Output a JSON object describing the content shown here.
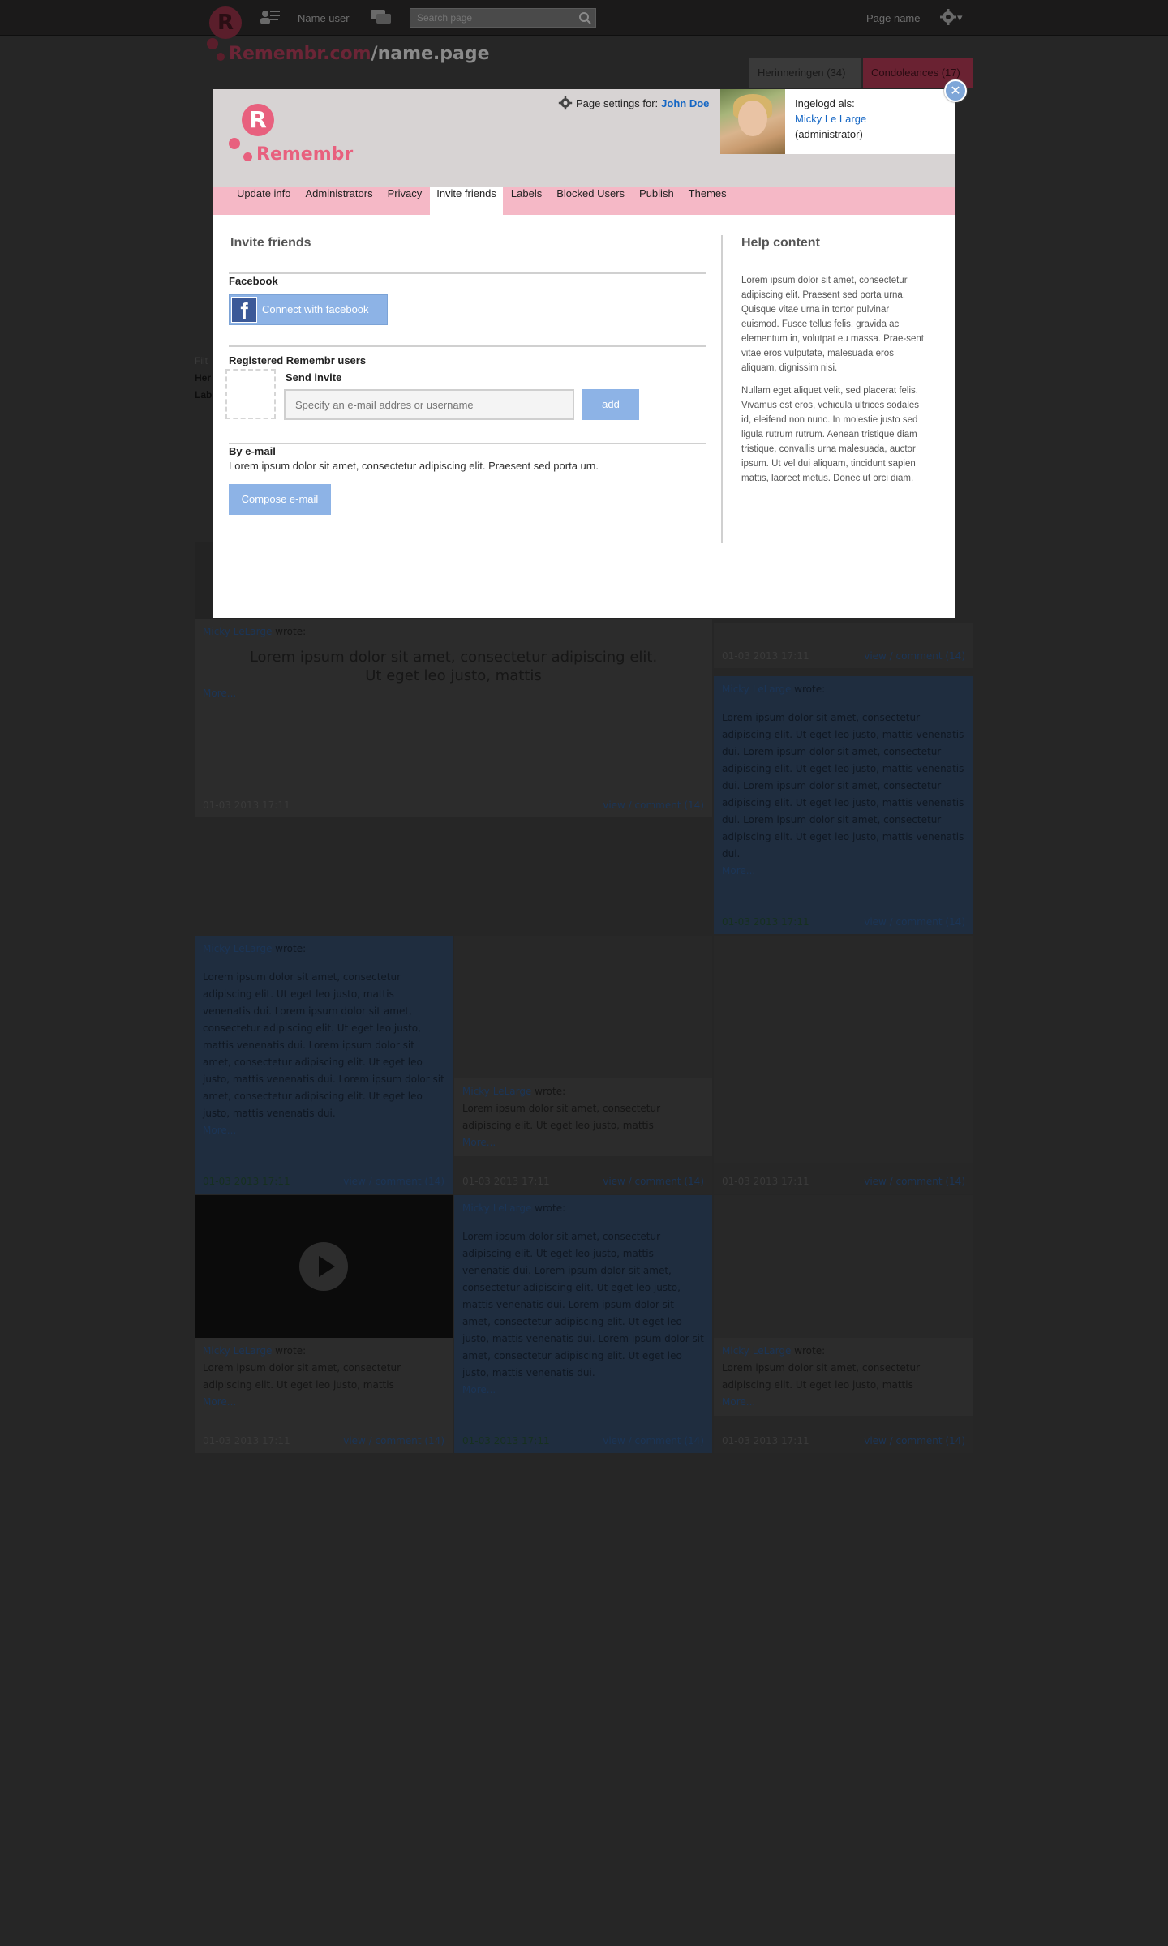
{
  "topbar": {
    "logo_letter": "R",
    "users_label": "Name user",
    "search_placeholder": "Search page",
    "page_name": "Page name",
    "settings_caret": "▾"
  },
  "header": {
    "site_brand": "Remembr.com",
    "separator": "/",
    "site_page": "name.page",
    "tab_memories": "Herinneringen (34)",
    "tab_condolences": "Condoleances (17)"
  },
  "feed": {
    "side_labels": [
      "Filt",
      "Her",
      "Lab"
    ],
    "author": "Micky LeLarge",
    "wrote": "wrote:",
    "quote_line1": "Lorem ipsum dolor sit amet, consectetur adipiscing elit.",
    "quote_line2": "Ut eget leo justo, mattis",
    "short_text": "Lorem ipsum dolor sit amet, consectetur adipiscing elit. Ut eget leo justo, mattis",
    "long_text": "Lorem ipsum dolor sit amet, consectetur adipiscing elit. Ut eget leo justo, mattis venenatis dui.  Lorem ipsum dolor sit amet, consectetur adipiscing elit. Ut eget leo justo, mattis venenatis dui. Lorem ipsum dolor sit amet, consectetur adipiscing elit. Ut eget leo justo, mattis venenatis dui. Lorem ipsum dolor sit amet, consectetur adipiscing elit. Ut eget leo justo, mattis venenatis dui.",
    "more": "More...",
    "date": "01-03 2013 17:11",
    "links": "view / comment (14)"
  },
  "modal": {
    "logo_letter": "R",
    "logo_word": "Remembr",
    "page_settings_label": "Page settings for:",
    "page_owner": "John Doe",
    "logged_in_label": "Ingelogd als:",
    "user_name": "Micky Le Large",
    "user_role": "(administrator)",
    "close_symbol": "✕",
    "tabs": [
      {
        "label": "Update info"
      },
      {
        "label": "Administrators"
      },
      {
        "label": "Privacy"
      },
      {
        "label": "Invite friends"
      },
      {
        "label": "Labels"
      },
      {
        "label": "Blocked Users"
      },
      {
        "label": "Publish"
      },
      {
        "label": "Themes"
      }
    ],
    "active_tab": "Invite friends",
    "invite": {
      "title": "Invite friends",
      "facebook_label": "Facebook",
      "facebook_button": "Connect with facebook",
      "facebook_glyph": "f",
      "registered_label": "Registered Remembr users",
      "send_invite_label": "Send invite",
      "invite_placeholder": "Specify an e-mail addres or username",
      "add_button": "add",
      "email_label": "By e-mail",
      "email_desc": "Lorem ipsum dolor sit amet, consectetur adipiscing elit. Praesent sed porta urn.",
      "compose_button": "Compose e-mail"
    },
    "help": {
      "title": "Help content",
      "paragraph1": "Lorem ipsum dolor sit amet, consectetur adipiscing elit. Praesent sed porta urna. Quisque vitae urna in tortor pulvinar euismod. Fusce tellus felis, gravida ac elementum in, volutpat eu massa. Prae-sent vitae eros vulputate, malesuada eros aliquam, dignissim nisi.",
      "paragraph2": "Nullam eget aliquet velit, sed placerat felis. Vivamus est eros, vehicula ultrices sodales id, eleifend non nunc. In molestie justo sed ligula rutrum rutrum. Aenean tristique diam tristique, convallis urna malesuada, auctor ipsum. Ut vel dui aliquam, tincidunt sapien mattis, laoreet metus. Donec ut orci diam."
    }
  },
  "colors": {
    "brand_pink": "#e8607e",
    "tab_bar_pink": "#f5b8c6",
    "button_blue": "#8db3e6",
    "link_blue": "#1466c4",
    "facebook_blue": "#3b5998"
  },
  "icons": [
    "logo-r-icon",
    "users-icon",
    "chat-icon",
    "search-icon",
    "gear-icon",
    "facebook-icon",
    "close-icon",
    "play-icon"
  ]
}
